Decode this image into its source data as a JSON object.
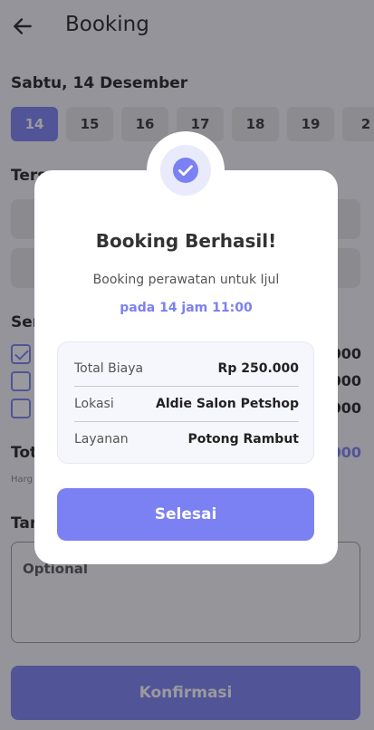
{
  "appbar": {
    "title": "Booking",
    "back_icon": "arrow-left-icon"
  },
  "date_section": {
    "label": "Sabtu, 14 Desember",
    "dates": [
      "14",
      "15",
      "16",
      "17",
      "18",
      "19",
      "2"
    ],
    "selected_index": 0
  },
  "slots_section": {
    "label": "Ters"
  },
  "services_section": {
    "label": "Ser",
    "items": [
      {
        "checked": true,
        "price": "000"
      },
      {
        "checked": false,
        "price": "000"
      },
      {
        "checked": false,
        "price": "000"
      }
    ]
  },
  "total_section": {
    "label": "Tot",
    "value": "000",
    "note": "Harg"
  },
  "notes_section": {
    "label": "Tan",
    "placeholder": "Optional"
  },
  "confirm_button": {
    "label": "Konfirmasi"
  },
  "modal": {
    "icon": "check-circle-icon",
    "title": "Booking Berhasil!",
    "message": "Booking perawatan untuk Ijul",
    "schedule": "pada 14 jam 11:00",
    "details": [
      {
        "key": "Total Biaya",
        "value": "Rp 250.000"
      },
      {
        "key": "Lokasi",
        "value": "Aldie Salon Petshop"
      },
      {
        "key": "Layanan",
        "value": "Potong Rambut"
      }
    ],
    "done_label": "Selesai"
  },
  "colors": {
    "accent": "#7b80f2",
    "overlay": "rgba(30,30,40,0.45)"
  }
}
